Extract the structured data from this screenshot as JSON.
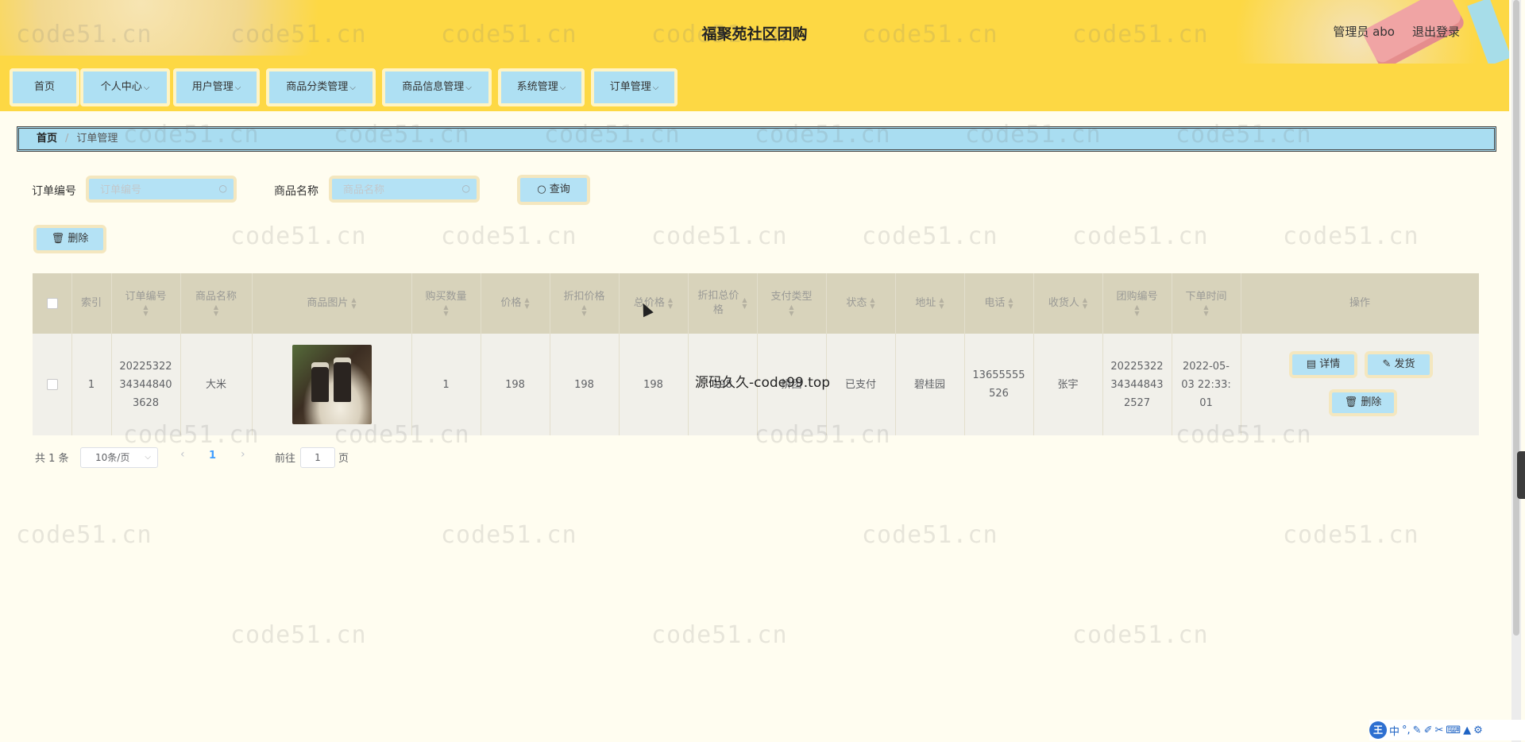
{
  "header": {
    "title": "福聚苑社区团购",
    "user": "管理员 abo",
    "logout": "退出登录"
  },
  "nav": [
    {
      "label": "首页",
      "has_dropdown": false
    },
    {
      "label": "个人中心",
      "has_dropdown": true
    },
    {
      "label": "用户管理",
      "has_dropdown": true
    },
    {
      "label": "商品分类管理",
      "has_dropdown": true
    },
    {
      "label": "商品信息管理",
      "has_dropdown": true
    },
    {
      "label": "系统管理",
      "has_dropdown": true
    },
    {
      "label": "订单管理",
      "has_dropdown": true
    }
  ],
  "breadcrumb": {
    "home": "首页",
    "separator": "/",
    "current": "订单管理"
  },
  "search": {
    "order_label": "订单编号",
    "order_placeholder": "订单编号",
    "product_label": "商品名称",
    "product_placeholder": "商品名称",
    "query_button": "查询"
  },
  "toolbar": {
    "delete_button": "删除"
  },
  "table": {
    "headers": [
      "索引",
      "订单编号",
      "商品名称",
      "商品图片",
      "购买数量",
      "价格",
      "折扣价格",
      "总价格",
      "折扣总价格",
      "支付类型",
      "状态",
      "地址",
      "电话",
      "收货人",
      "团购编号",
      "下单时间",
      "操作"
    ],
    "rows": [
      {
        "index": "1",
        "order_no": "202253223434484036 28",
        "order_no_lines": [
          "20225322",
          "34344840",
          "3628"
        ],
        "product_name": "大米",
        "image_alt": "rice-product-photo",
        "quantity": "1",
        "price": "198",
        "discount_price": "198",
        "total_price": "198",
        "discount_total": "198",
        "pay_type": "拼团",
        "status": "已支付",
        "address": "碧桂园",
        "phone_lines": [
          "13655555",
          "526"
        ],
        "receiver": "张宇",
        "group_no_lines": [
          "20225322",
          "34344843",
          "2527"
        ],
        "order_time_lines": [
          "2022-05-",
          "03 22:33:",
          "01"
        ],
        "actions": {
          "detail": "详情",
          "ship": "发货",
          "delete": "删除"
        }
      }
    ]
  },
  "pagination": {
    "total": "共 1 条",
    "page_size": "10条/页",
    "current_page": "1",
    "goto_prefix": "前往",
    "goto_value": "1",
    "goto_suffix": "页"
  },
  "overlay": {
    "text": "源码久久-code99.top",
    "watermark": "code51.cn"
  },
  "ime": {
    "chars": "中"
  },
  "colors": {
    "header_bg": "#fdd844",
    "button_bg": "#b4e2f5",
    "page_bg": "#fffdf0",
    "table_head_bg": "#d8d3bb"
  }
}
